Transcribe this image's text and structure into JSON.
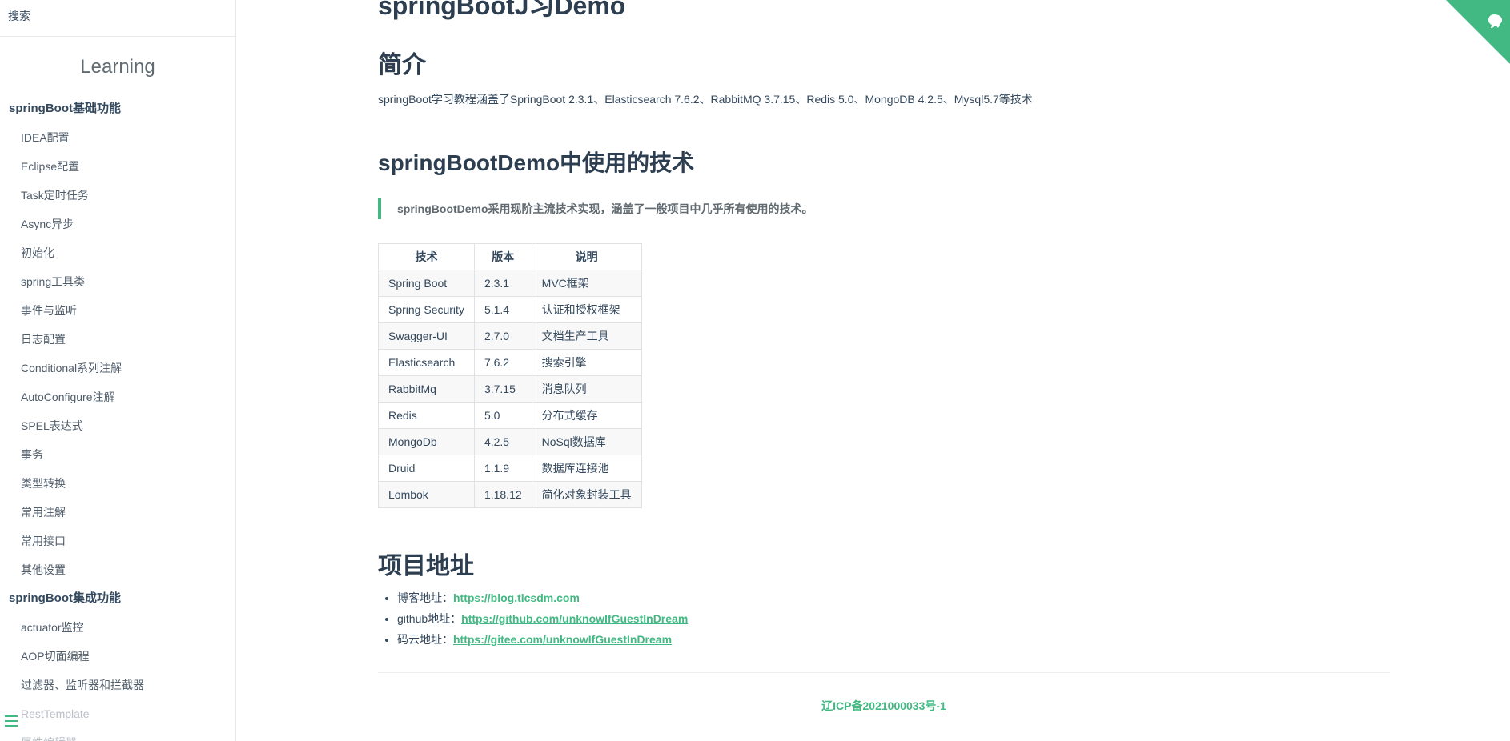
{
  "search": {
    "placeholder": "搜索"
  },
  "sidebar": {
    "app_name": "Learning",
    "groups": [
      {
        "title": "springBoot基础功能",
        "items": [
          "IDEA配置",
          "Eclipse配置",
          "Task定时任务",
          "Async异步",
          "初始化",
          "spring工具类",
          "事件与监听",
          "日志配置",
          "Conditional系列注解",
          "AutoConfigure注解",
          "SPEL表达式",
          "事务",
          "类型转换",
          "常用注解",
          "常用接口",
          "其他设置"
        ]
      },
      {
        "title": "springBoot集成功能",
        "items": [
          "actuator监控",
          "AOP切面编程",
          "过滤器、监听器和拦截器",
          "RestTemplate",
          "属性编辑器"
        ]
      }
    ]
  },
  "main": {
    "partial_title": "springBootJ习Demo",
    "intro_heading": "简介",
    "intro_text": "springBoot学习教程涵盖了SpringBoot 2.3.1、Elasticsearch 7.6.2、RabbitMQ 3.7.15、Redis 5.0、MongoDB 4.2.5、Mysql5.7等技术",
    "tech_heading": "springBootDemo中使用的技术",
    "quote": "springBootDemo采用现阶主流技术实现，涵盖了一般项目中几乎所有使用的技术。",
    "table": {
      "headers": [
        "技术",
        "版本",
        "说明"
      ],
      "rows": [
        [
          "Spring Boot",
          "2.3.1",
          "MVC框架"
        ],
        [
          "Spring Security",
          "5.1.4",
          "认证和授权框架"
        ],
        [
          "Swagger-UI",
          "2.7.0",
          "文档生产工具"
        ],
        [
          "Elasticsearch",
          "7.6.2",
          "搜索引擎"
        ],
        [
          "RabbitMq",
          "3.7.15",
          "消息队列"
        ],
        [
          "Redis",
          "5.0",
          "分布式缓存"
        ],
        [
          "MongoDb",
          "4.2.5",
          "NoSql数据库"
        ],
        [
          "Druid",
          "1.1.9",
          "数据库连接池"
        ],
        [
          "Lombok",
          "1.18.12",
          "简化对象封装工具"
        ]
      ]
    },
    "address_heading": "项目地址",
    "links": [
      {
        "label": "博客地址：",
        "url": "https://blog.tlcsdm.com"
      },
      {
        "label": "github地址：",
        "url": "https://github.com/unknowIfGuestInDream"
      },
      {
        "label": "码云地址：",
        "url": "https://gitee.com/unknowIfGuestInDream"
      }
    ]
  },
  "footer": {
    "icp": "辽ICP备2021000033号-1"
  },
  "colors": {
    "accent": "#42b983",
    "text": "#34495e",
    "heading": "#2c3e50"
  },
  "icons": {
    "corner": "github-corner-icon",
    "menu": "menu-icon"
  }
}
